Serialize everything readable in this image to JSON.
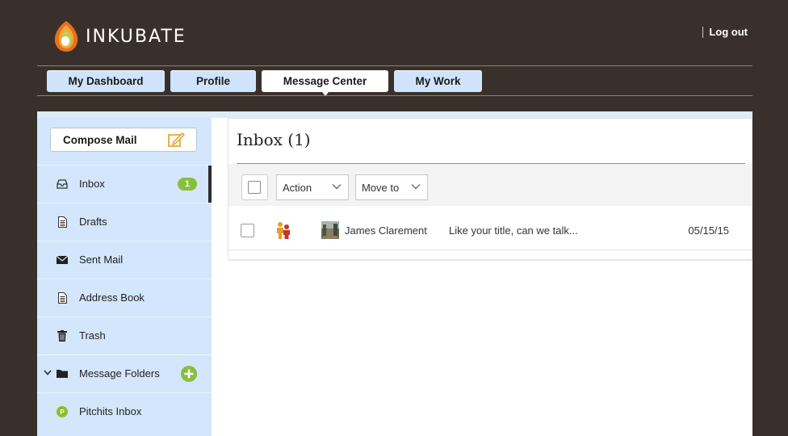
{
  "brand": {
    "name": "INKUBATE"
  },
  "header": {
    "logout": "Log out"
  },
  "nav": {
    "tabs": [
      {
        "label": "My Dashboard"
      },
      {
        "label": "Profile"
      },
      {
        "label": "Message Center"
      },
      {
        "label": "My Work"
      }
    ],
    "active": "Message Center"
  },
  "sidebar": {
    "compose": "Compose Mail",
    "items": [
      {
        "label": "Inbox",
        "icon": "inbox-icon",
        "badge": "1"
      },
      {
        "label": "Drafts",
        "icon": "document-icon"
      },
      {
        "label": "Sent Mail",
        "icon": "envelope-icon"
      },
      {
        "label": "Address Book",
        "icon": "document-icon"
      },
      {
        "label": "Trash",
        "icon": "trash-icon"
      },
      {
        "label": "Message Folders",
        "icon": "folder-icon"
      },
      {
        "label": "Pitchits Inbox",
        "icon": "pitchits-icon"
      }
    ]
  },
  "main": {
    "title": "Inbox (1)",
    "toolbar": {
      "action": "Action",
      "move_to": "Move to"
    },
    "messages": [
      {
        "sender": "James Clarement",
        "subject": "Like your title, can we talk...",
        "date": "05/15/15"
      }
    ]
  },
  "colors": {
    "background": "#3a302b",
    "tab": "#cfe4fb",
    "sidebar": "#d3e6fb",
    "badge": "#87bf3d"
  }
}
